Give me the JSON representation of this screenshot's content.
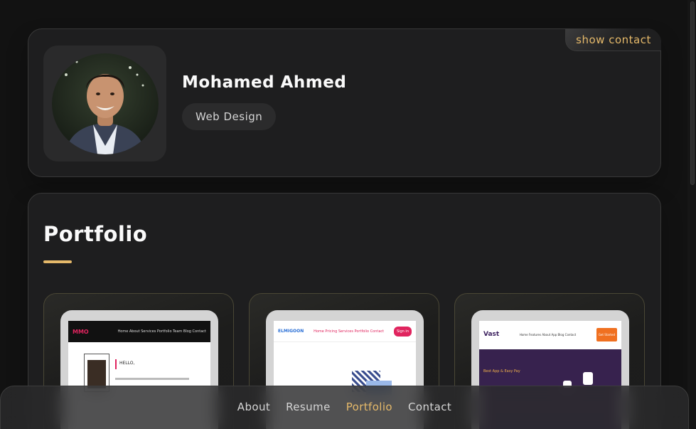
{
  "profile": {
    "name": "Mohamed Ahmed",
    "role": "Web Design",
    "show_contact_label": "show contact"
  },
  "portfolio": {
    "title": "Portfolio",
    "projects": [
      {
        "name": "project-1",
        "nav_brand": "MMO",
        "nav_links": "Home About Services Portfolio Team Blog Contact",
        "hero_text": "HELLO,"
      },
      {
        "name": "project-2",
        "nav_brand": "ELMIGOON",
        "nav_links": "Home Pricing Services Portfolio Contact",
        "button_text": "Sign in"
      },
      {
        "name": "project-3",
        "nav_brand": "Vast",
        "nav_links": "Home Features About App Blog Contact",
        "button_text": "Get Started",
        "hero_text": "Best App & Easy Pay"
      }
    ]
  },
  "navbar": {
    "items": [
      "About",
      "Resume",
      "Portfolio",
      "Contact"
    ],
    "active": "Portfolio"
  },
  "colors": {
    "accent": "#e5b96a",
    "background": "#121212",
    "card": "#1e1e1f"
  }
}
